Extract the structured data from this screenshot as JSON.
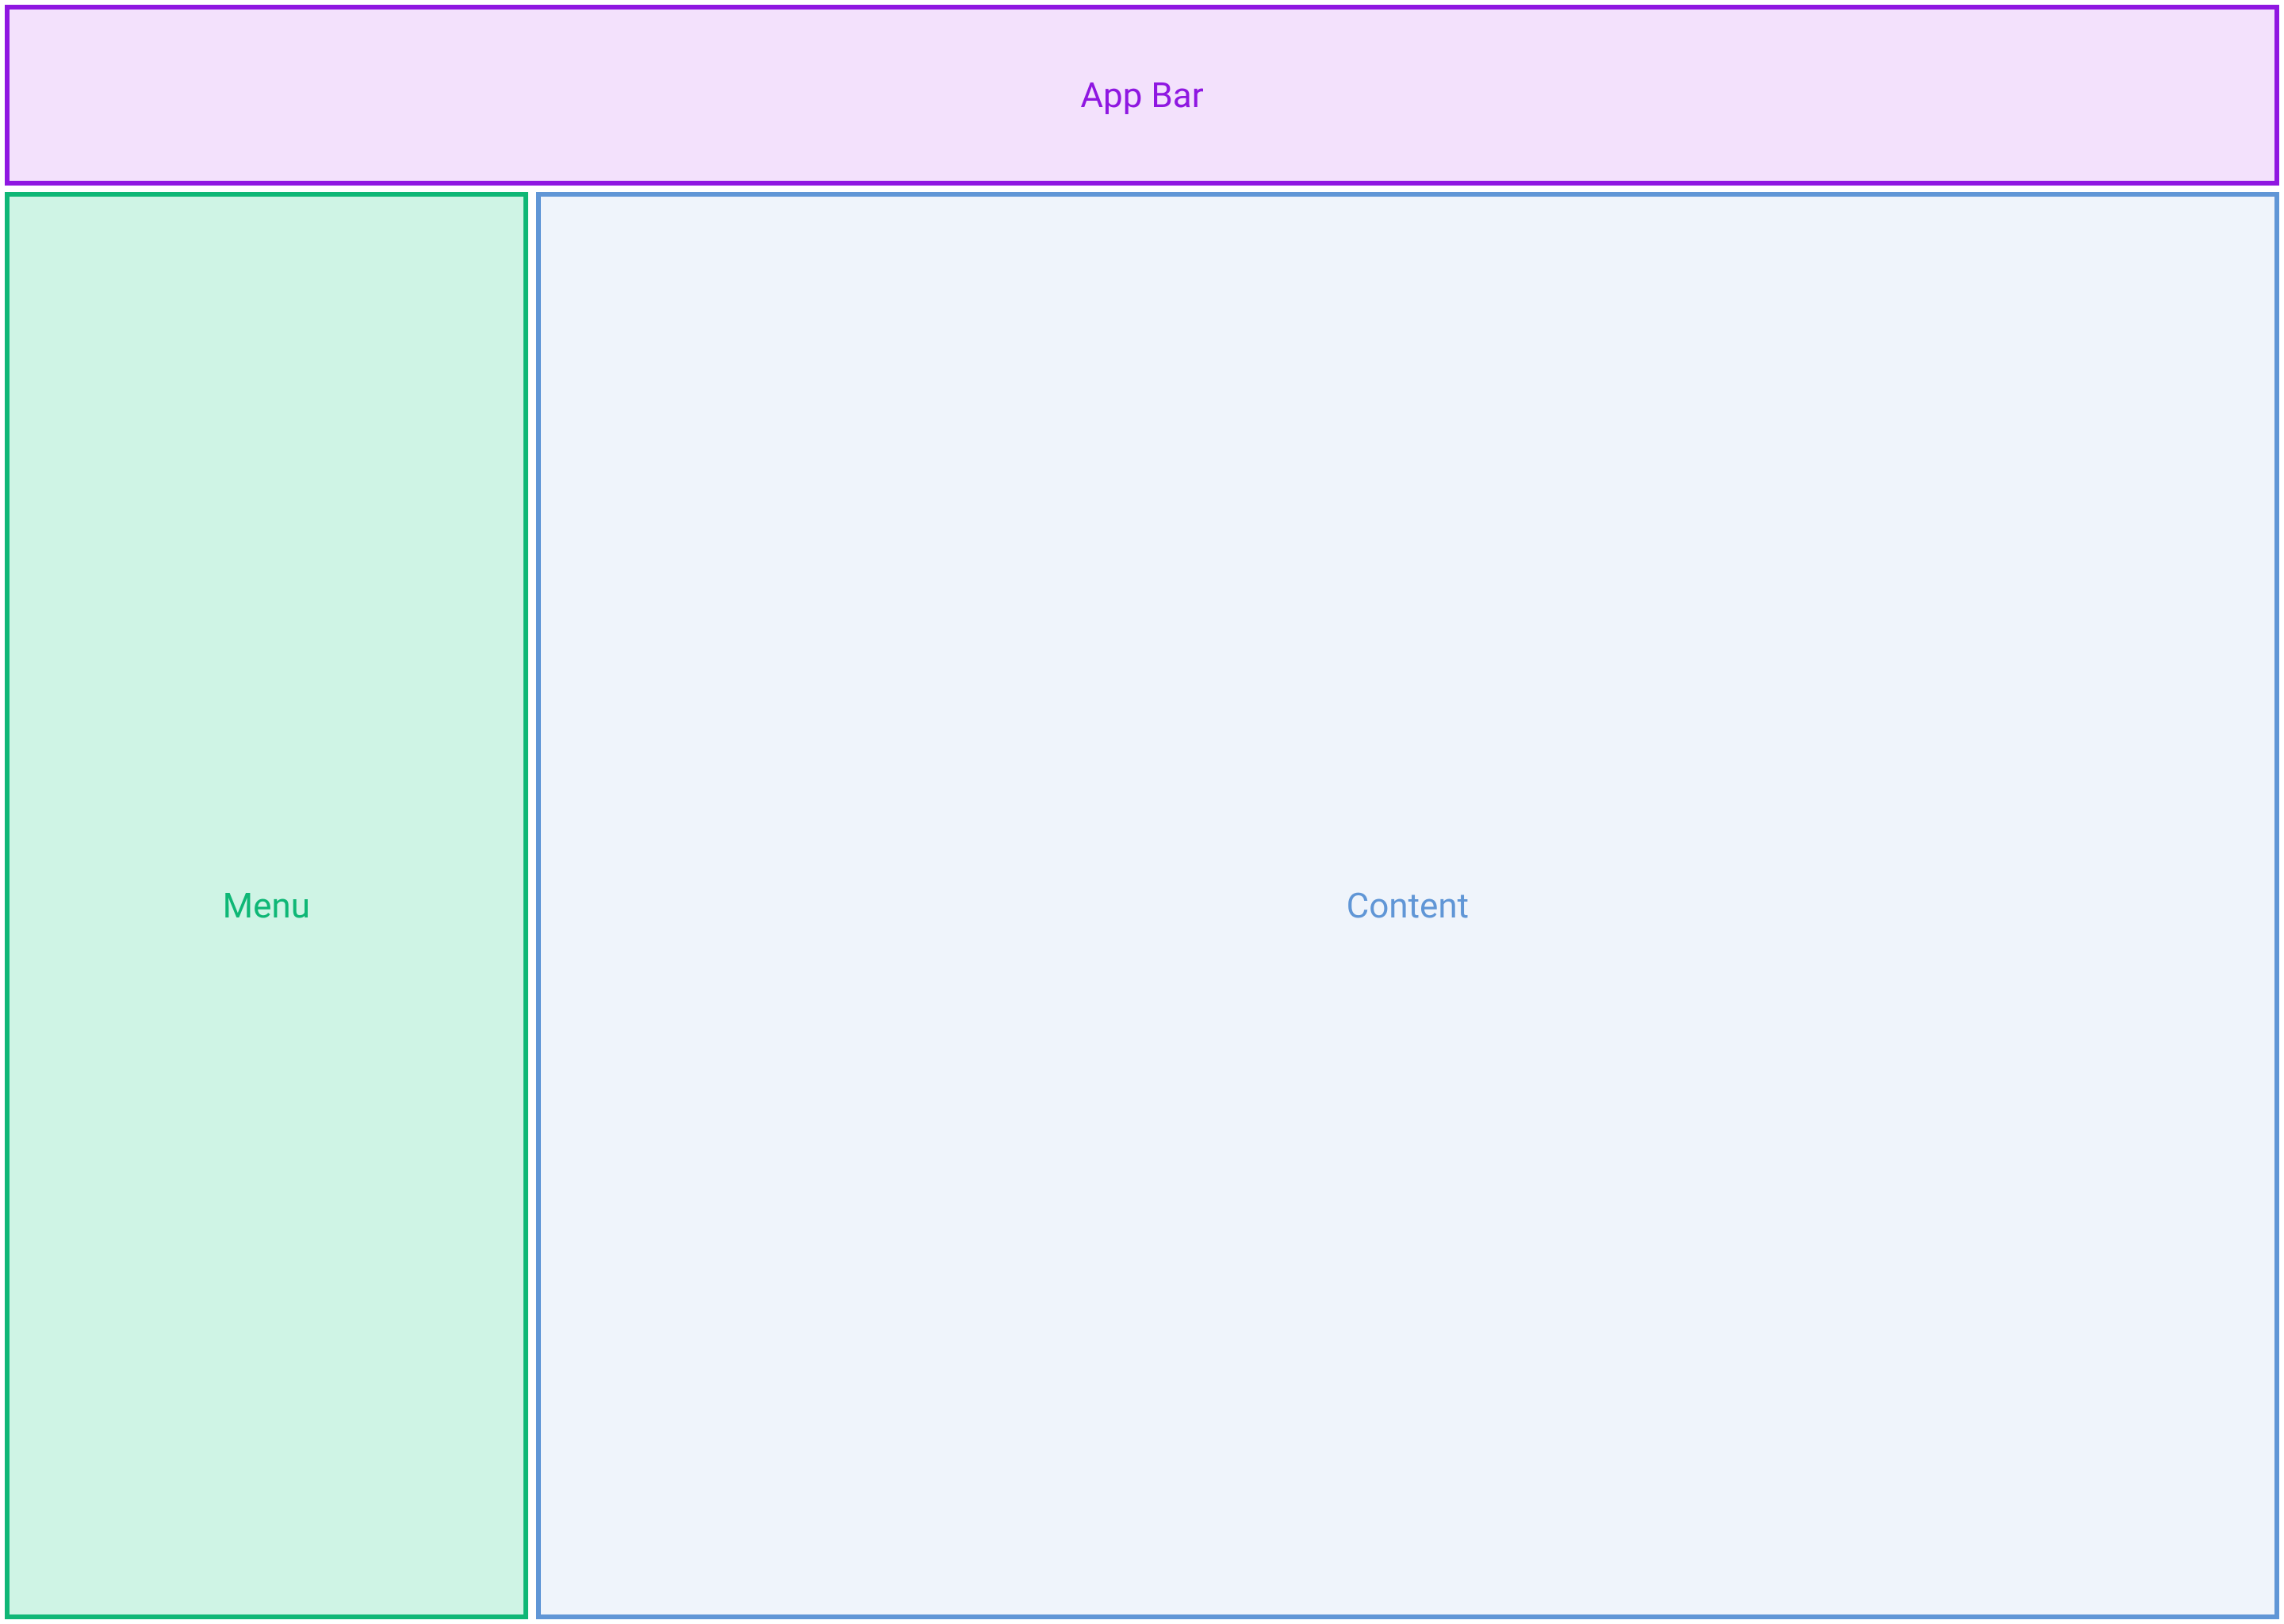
{
  "appbar": {
    "label": "App Bar"
  },
  "menu": {
    "label": "Menu"
  },
  "content": {
    "label": "Content"
  }
}
